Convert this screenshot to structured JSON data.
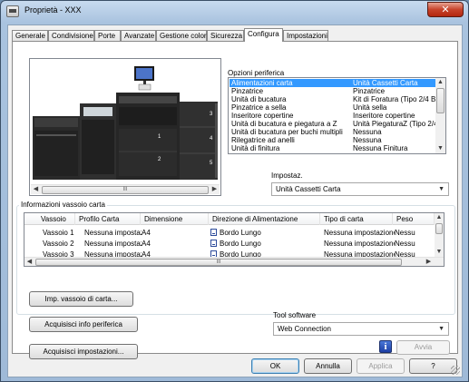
{
  "window": {
    "title": "Proprietà - XXX",
    "close_glyph": "✕"
  },
  "tabs": [
    {
      "label": "Generale"
    },
    {
      "label": "Condivisione"
    },
    {
      "label": "Porte"
    },
    {
      "label": "Avanzate"
    },
    {
      "label": "Gestione colori"
    },
    {
      "label": "Sicurezza"
    },
    {
      "label": "Configura",
      "active": true
    },
    {
      "label": "Impostazioni"
    }
  ],
  "device_options": {
    "title": "Opzioni periferica",
    "items": [
      {
        "name": "Alimentazioni carta",
        "value": "Unità Cassetti Carta",
        "selected": true
      },
      {
        "name": "Pinzatrice",
        "value": "Pinzatrice"
      },
      {
        "name": "Unità di bucatura",
        "value": "Kit di Foratura (Tipo 2/4 B"
      },
      {
        "name": "Pinzatrice a sella",
        "value": "Unità sella"
      },
      {
        "name": "Inseritore copertine",
        "value": "Inseritore copertine"
      },
      {
        "name": "Unità di bucatura e piegatura a Z",
        "value": "Unità PiegaturaZ (Tipo 2/4"
      },
      {
        "name": "Unità di bucatura per buchi multipli",
        "value": "Nessuna"
      },
      {
        "name": "Rilegatrice ad anelli",
        "value": "Nessuna"
      },
      {
        "name": "Unità di finitura",
        "value": "Nessuna Finitura"
      }
    ],
    "setting_label": "Impostaz.",
    "setting_value": "Unità Cassetti Carta"
  },
  "printer_image": {
    "tray_markers": [
      "3",
      "4",
      "1",
      "2",
      "5"
    ]
  },
  "scroll_grip": "III",
  "tray_info": {
    "title": "Informazioni vassoio carta",
    "columns": [
      "Vassoio",
      "Profilo Carta",
      "Dimensione",
      "Direzione di Alimentazione",
      "Tipo di carta",
      "Peso"
    ],
    "rows": [
      {
        "tray": "Vassoio 1",
        "profile": "Nessuna impostaz",
        "size": "A4",
        "direction": "Bordo Lungo",
        "type": "Nessuna impostazione",
        "weight": "Nessu"
      },
      {
        "tray": "Vassoio 2",
        "profile": "Nessuna impostaz",
        "size": "A4",
        "direction": "Bordo Lungo",
        "type": "Nessuna impostazione",
        "weight": "Nessu"
      },
      {
        "tray": "Vassoio 3",
        "profile": "Nessuna impostaz",
        "size": "A4",
        "direction": "Bordo Lungo",
        "type": "Nessuna impostazione",
        "weight": "Nessu"
      }
    ],
    "tray_button": "Imp. vassoio di carta..."
  },
  "actions": {
    "acquire_device": "Acquisisci info periferica",
    "acquire_settings": "Acquisisci impostazioni..."
  },
  "software_tool": {
    "label": "Tool software",
    "value": "Web Connection",
    "info_glyph": "i",
    "send_button": "Avvia"
  },
  "footer": {
    "ok": "OK",
    "cancel": "Annulla",
    "apply": "Applica",
    "help": "?"
  }
}
